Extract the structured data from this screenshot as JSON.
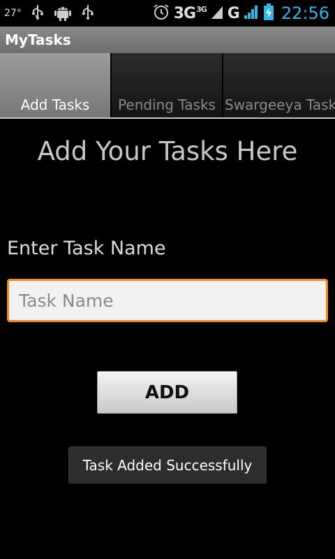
{
  "status_bar": {
    "temperature": "27°",
    "network_1": "3G",
    "network_1_sup": "3G",
    "network_2": "G",
    "time": "22:56",
    "icons": [
      "usb-icon",
      "android-debug-icon",
      "usb-icon",
      "alarm-icon",
      "signal-icon",
      "battery-charging-icon"
    ]
  },
  "app": {
    "title": "MyTasks"
  },
  "tabs": [
    {
      "label": "Add Tasks",
      "active": true
    },
    {
      "label": "Pending Tasks",
      "active": false
    },
    {
      "label": "Swargeeya Task",
      "active": false
    }
  ],
  "main": {
    "heading": "Add Your Tasks Here",
    "field_label": "Enter Task Name",
    "input_value": "",
    "input_placeholder": "Task Name",
    "add_button": "ADD",
    "toast": "Task Added Successfully"
  },
  "colors": {
    "accent_time": "#33b5e5",
    "input_focus_border": "#f5891a",
    "title_bar": "#7c7c7c"
  }
}
